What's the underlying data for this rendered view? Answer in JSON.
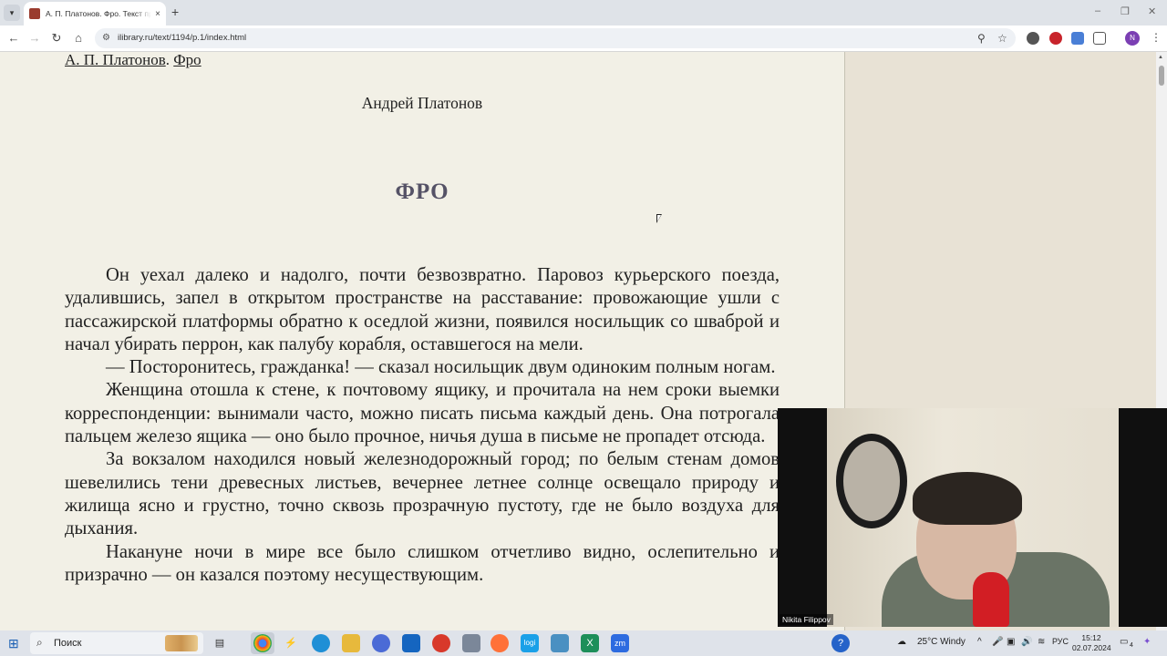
{
  "browser": {
    "tab_title": "А. П. Платонов. Фро. Текст пр",
    "tab_close": "×",
    "new_tab": "+",
    "url": "ilibrary.ru/text/1194/p.1/index.html",
    "window_controls": {
      "minimize": "–",
      "restore": "❐",
      "close": "✕"
    }
  },
  "page": {
    "breadcrumb": {
      "author_link": "А. П. Платонов",
      "separator": ". ",
      "work_link": "Фро"
    },
    "author": "Андрей Платонов",
    "title": "ФРО",
    "paragraphs": [
      "Он уехал далеко и надолго, почти безвозвратно. Паровоз курьерского поезда, удалившись, запел в открытом пространстве на расставание: провожающие ушли с пассажирской платформы обратно к оседлой жизни, появился носильщик со шваброй и начал убирать перрон, как палубу корабля, оставшегося на мели.",
      "— Посторонитесь, гражданка! — сказал носильщик двум одиноким полным ногам.",
      "Женщина отошла к стене, к почтовому ящику, и прочитала на нем сроки вы­емки корреспонденции: вынимали часто, можно писать письма каждый день. Она потрогала пальцем железо ящика — оно было прочное, ничья душа в письме не пропадет отсюда.",
      "За вокзалом находился новый железнодорожный город; по белым стенам до­мов шевелились тени древесных листьев, вечернее летнее солнце освещало при­роду и жилища ясно и грустно, точно сквозь прозрачную пустоту, где не было воздуха для дыхания.",
      "Накануне ночи в мире все было слишком отчетливо видно, ослепительно и призрачно — он казался поэтому несуществующим."
    ]
  },
  "webcam": {
    "name": "Nikita Filippov"
  },
  "taskbar": {
    "search_label": "Поиск",
    "weather": "25°C  Windy",
    "language": "РУС",
    "time": "15:12",
    "date": "02.07.2024",
    "notifications": "4"
  },
  "colors": {
    "page_bg": "#f2f0e6",
    "right_pane": "#e8e2d5",
    "title": "#555266"
  }
}
